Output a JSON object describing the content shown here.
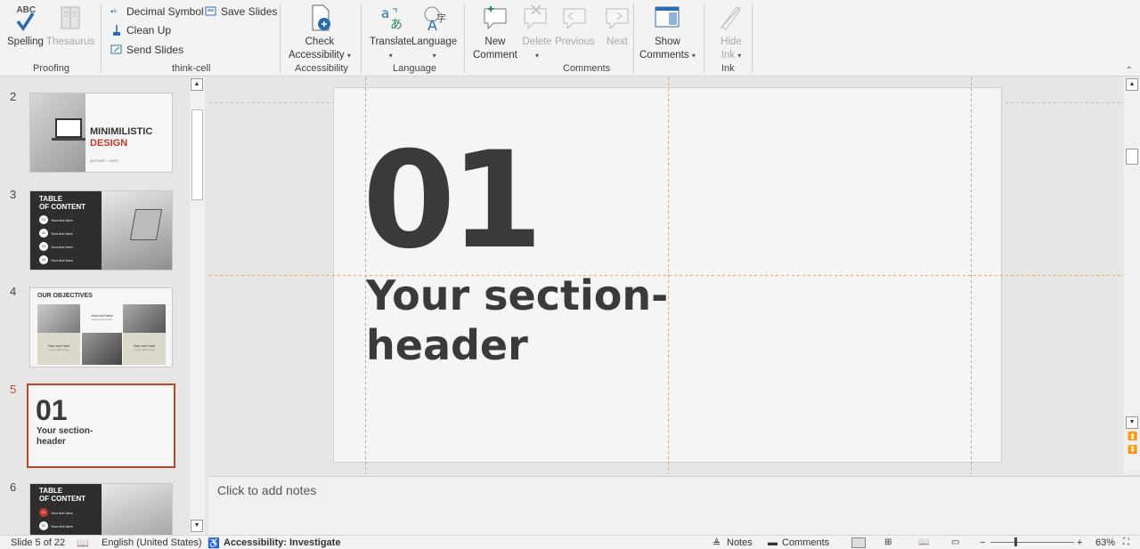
{
  "ribbon": {
    "proofing": {
      "spelling": "Spelling",
      "thesaurus": "Thesaurus",
      "group_label": "Proofing",
      "abc": "ABC"
    },
    "thinkcell": {
      "decimal_symbol": "Decimal Symbol",
      "save_slides": "Save Slides",
      "clean_up": "Clean Up",
      "send_slides": "Send Slides",
      "group_label": "think-cell"
    },
    "accessibility": {
      "check_line1": "Check",
      "check_line2": "Accessibility",
      "group_label": "Accessibility"
    },
    "language": {
      "translate": "Translate",
      "language": "Language",
      "group_label": "Language"
    },
    "comments": {
      "new_line1": "New",
      "new_line2": "Comment",
      "delete": "Delete",
      "previous": "Previous",
      "next": "Next",
      "show_line1": "Show",
      "show_line2": "Comments",
      "group_label": "Comments"
    },
    "ink": {
      "hide_line1": "Hide",
      "hide_line2": "Ink",
      "group_label": "Ink"
    }
  },
  "thumbnails": [
    {
      "num": "2",
      "title1": "MINIMILISTIC",
      "title2": "DESIGN",
      "sub": "AUTHOR – DATE"
    },
    {
      "num": "3",
      "title1": "TABLE",
      "title2": "OF CONTENT",
      "items": [
        "01",
        "02",
        "03",
        "04"
      ],
      "item_text": "Your text here"
    },
    {
      "num": "4",
      "title": "OUR OBJECTIVES",
      "item_text": "Your text here",
      "sub_text": "Lorem ipsum text"
    },
    {
      "num": "5",
      "big": "01",
      "line1": "Your section-",
      "line2": "header"
    },
    {
      "num": "6",
      "title1": "TABLE",
      "title2": "OF CONTENT",
      "items": [
        "01",
        "02"
      ],
      "item_text": "Your text here"
    }
  ],
  "slide": {
    "number": "01",
    "line1": "Your section-",
    "line2": "header"
  },
  "notes": {
    "placeholder": "Click to add notes"
  },
  "status": {
    "slide_count": "Slide 5 of 22",
    "language": "English (United States)",
    "accessibility": "Accessibility: Investigate",
    "notes": "Notes",
    "comments": "Comments",
    "zoom": "63%"
  },
  "colors": {
    "accent": "#c0392b",
    "selected_border": "#b7472a",
    "guide": "#f0a050",
    "dark_text": "#3a3a3a"
  }
}
